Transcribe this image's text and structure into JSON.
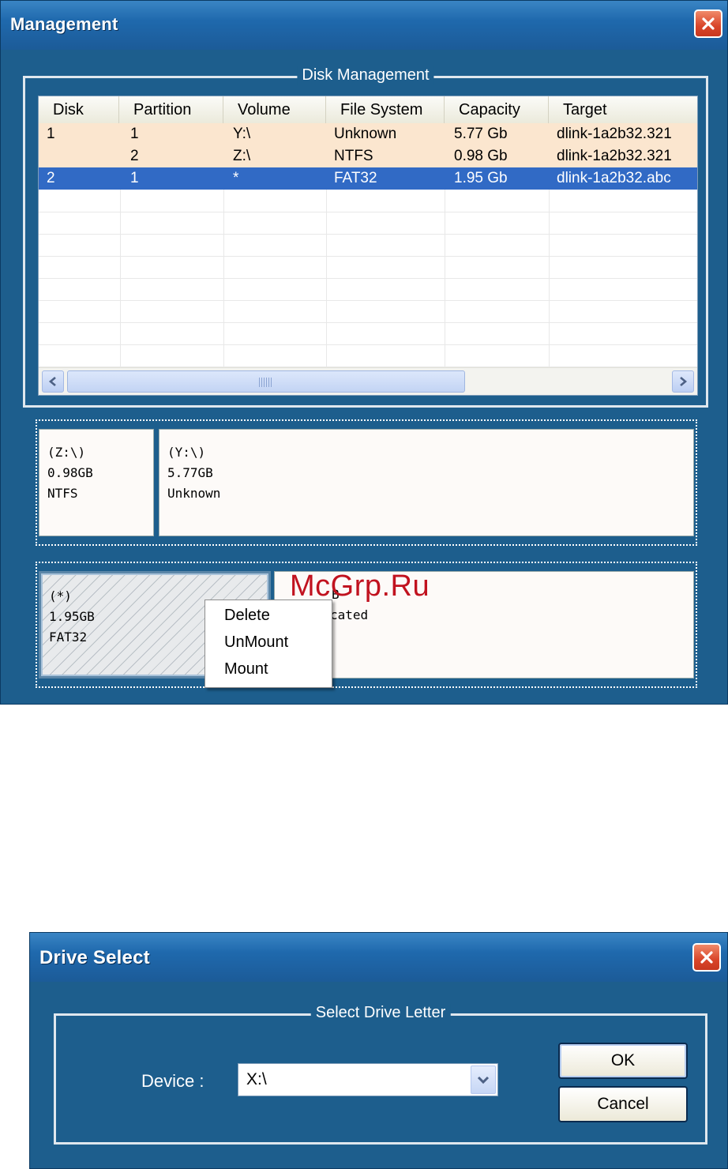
{
  "management": {
    "title": "Management",
    "group_title": "Disk Management",
    "columns": [
      "Disk",
      "Partition",
      "Volume",
      "File System",
      "Capacity",
      "Target"
    ],
    "rows": [
      {
        "disk": "1",
        "partition": "1",
        "volume": "Y:\\",
        "fs": "Unknown",
        "capacity": "5.77 Gb",
        "target": "dlink-1a2b32.321",
        "state": "tinted"
      },
      {
        "disk": "",
        "partition": "2",
        "volume": "Z:\\",
        "fs": "NTFS",
        "capacity": "0.98 Gb",
        "target": "dlink-1a2b32.321",
        "state": "tinted"
      },
      {
        "disk": "2",
        "partition": "1",
        "volume": "*",
        "fs": "FAT32",
        "capacity": "1.95 Gb",
        "target": "dlink-1a2b32.abc",
        "state": "selected"
      }
    ],
    "disk1": {
      "partitions": [
        {
          "line1": "(Z:\\)",
          "line2": "0.98GB",
          "line3": "NTFS"
        },
        {
          "line1": "(Y:\\)",
          "line2": "5.77GB",
          "line3": "Unknown"
        }
      ]
    },
    "disk2": {
      "partitions": [
        {
          "line1": "(*)",
          "line2": "1.95GB",
          "line3": "FAT32"
        },
        {
          "line1": "",
          "line2": "B",
          "line3": "cated"
        }
      ]
    },
    "context_menu": [
      "Delete",
      "UnMount",
      "Mount"
    ]
  },
  "watermark": "McGrp.Ru",
  "drive_select": {
    "title": "Drive Select",
    "group_title": "Select Drive Letter",
    "device_label": "Device :",
    "device_value": "X:\\",
    "ok_label": "OK",
    "cancel_label": "Cancel"
  },
  "colors": {
    "window_bg": "#1d5e8d",
    "selection": "#316ac5",
    "row_tint": "#fbe6cf",
    "watermark": "#c1121f"
  },
  "icons": [
    "close-icon",
    "scroll-left-icon",
    "scroll-right-icon",
    "dropdown-arrow-icon"
  ]
}
